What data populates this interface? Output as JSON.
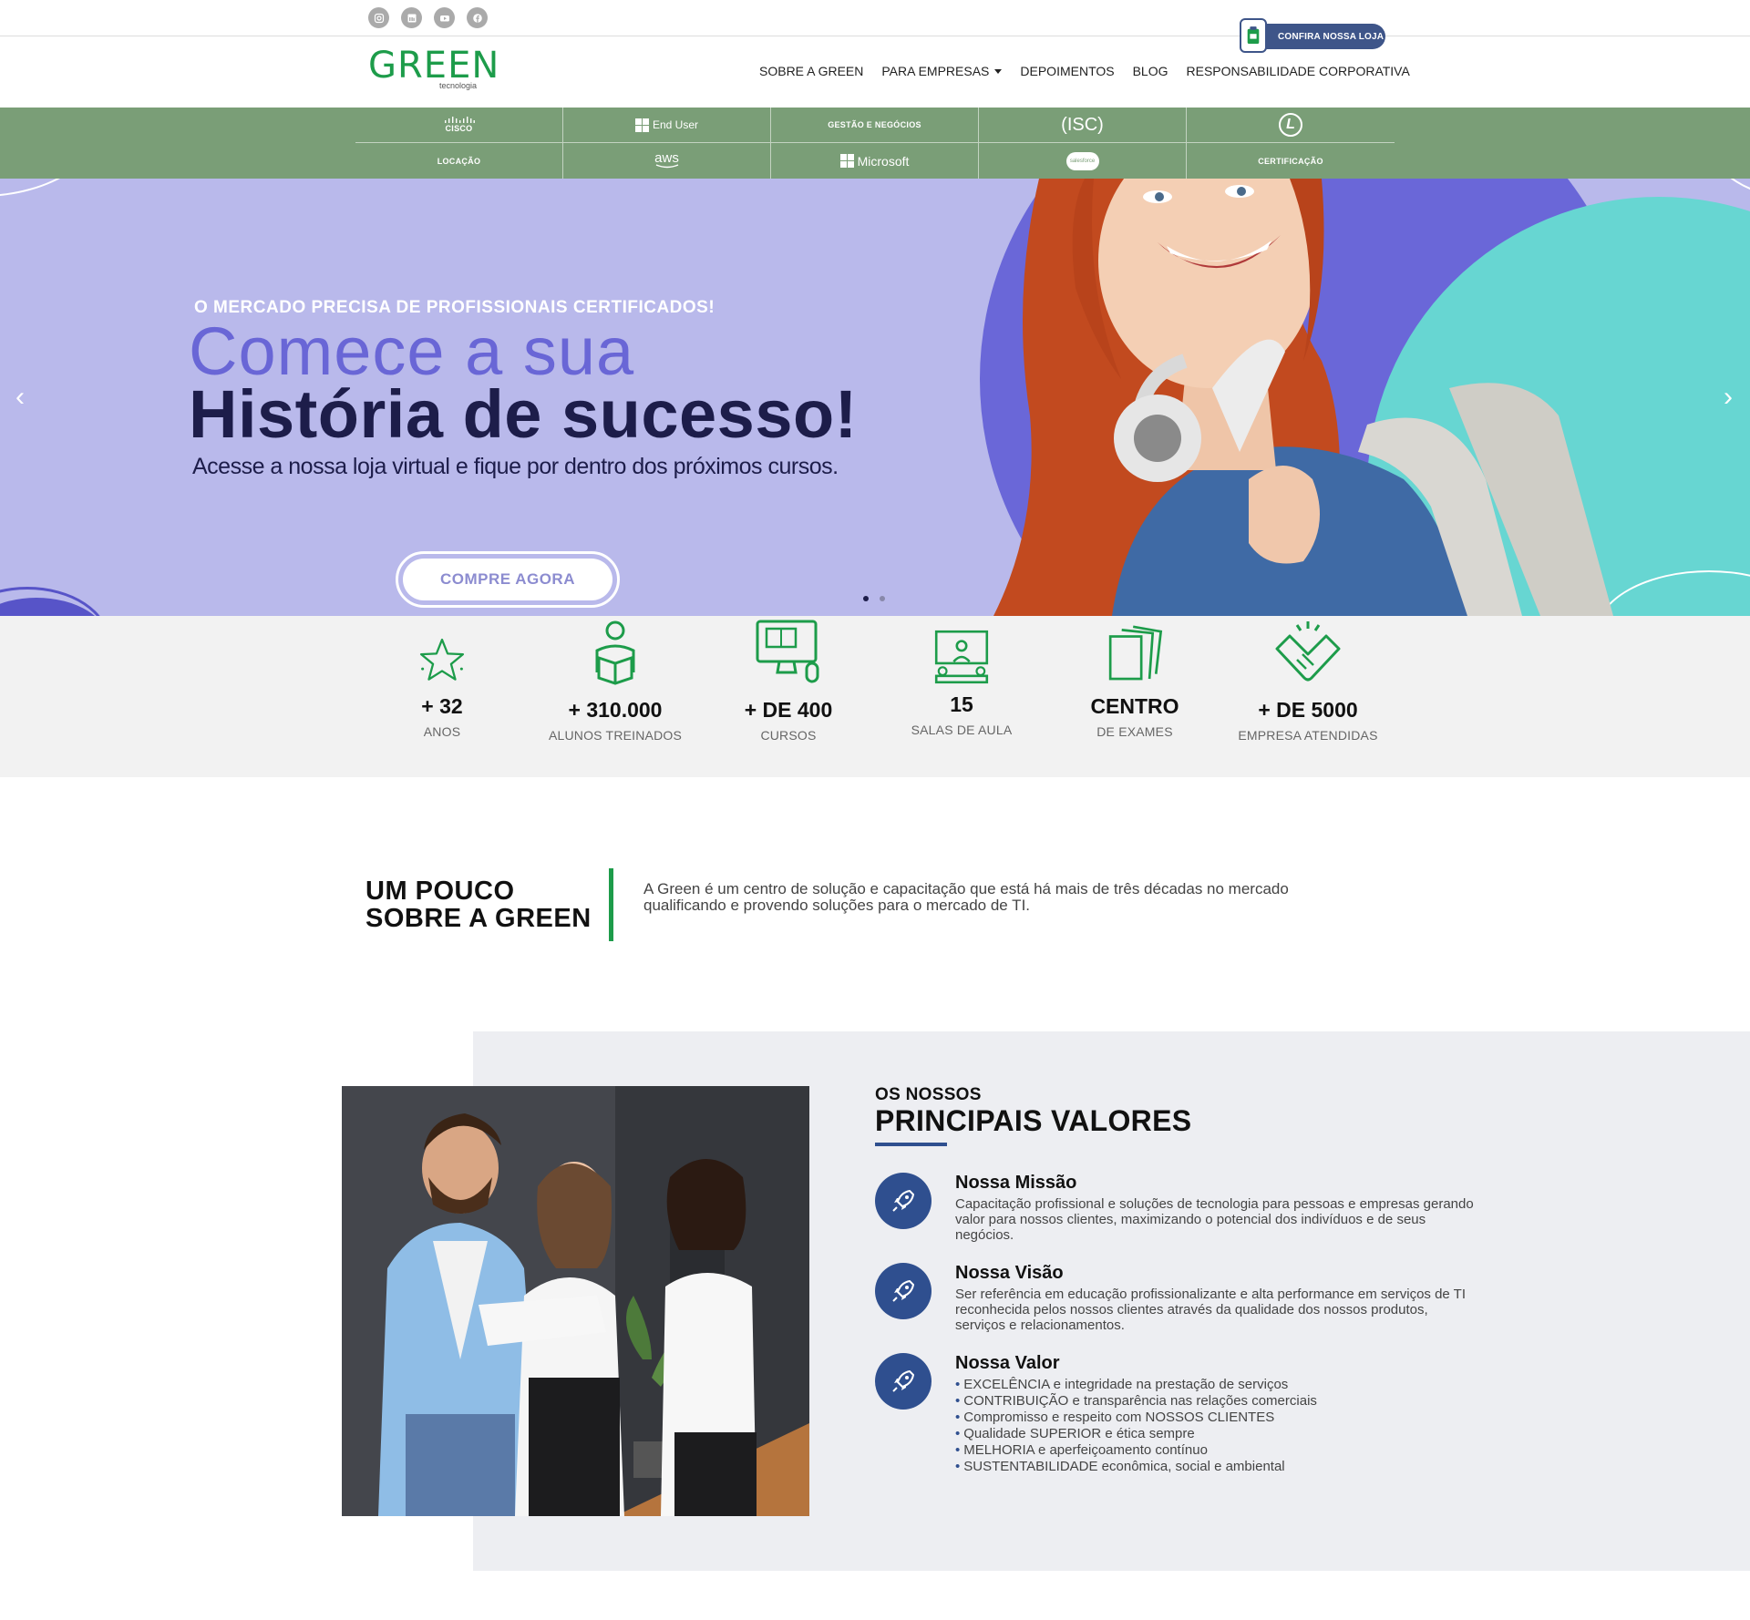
{
  "topbar": {
    "social": [
      "instagram-icon",
      "linkedin-icon",
      "youtube-icon",
      "facebook-icon"
    ],
    "store_label": "CONFIRA NOSSA LOJA"
  },
  "header": {
    "logo": "GREEN",
    "logo_sub": "tecnologia",
    "nav": [
      "SOBRE A GREEN",
      "PARA EMPRESAS",
      "DEPOIMENTOS",
      "BLOG",
      "RESPONSABILIDADE CORPORATIVA"
    ]
  },
  "partners": {
    "row1": [
      "CISCO",
      "End User",
      "GESTÃO E NEGÓCIOS",
      "(ISC)",
      "L"
    ],
    "row2": [
      "LOCAÇÃO",
      "aws",
      "Microsoft",
      "salesforce",
      "CERTIFICAÇÃO"
    ]
  },
  "hero": {
    "kicker": "O MERCADO PRECISA DE PROFISSIONAIS CERTIFICADOS!",
    "headline_light": "Comece a sua",
    "headline_bold": "História de sucesso!",
    "subtitle": "Acesse a nossa loja virtual e fique por dentro dos próximos cursos.",
    "cta": "COMPRE AGORA",
    "prev": "‹",
    "next": "›"
  },
  "stats": [
    {
      "icon": "star-icon",
      "value": "+ 32",
      "label": "ANOS"
    },
    {
      "icon": "student-reading-icon",
      "value": "+ 310.000",
      "label": "ALUNOS TREINADOS"
    },
    {
      "icon": "computer-course-icon",
      "value": "+ DE 400",
      "label": "CURSOS"
    },
    {
      "icon": "classroom-icon",
      "value": "15",
      "label": "SALAS DE AULA"
    },
    {
      "icon": "documents-icon",
      "value": "CENTRO",
      "label": "DE EXAMES"
    },
    {
      "icon": "handshake-icon",
      "value": "+ DE 5000",
      "label": "EMPRESA ATENDIDAS"
    }
  ],
  "about": {
    "title_1": "UM POUCO",
    "title_2": "SOBRE A GREEN",
    "text": "A Green é um centro de solução e capacitação que está há mais de três décadas no mercado qualificando e provendo soluções para o mercado de TI."
  },
  "values": {
    "kicker": "OS NOSSOS",
    "title": "PRINCIPAIS VALORES",
    "mission": {
      "title": "Nossa Missão",
      "text": "Capacitação profissional e soluções de tecnologia para pessoas e empresas gerando valor para nossos clientes, maximizando o potencial dos indivíduos e de seus negócios."
    },
    "vision": {
      "title": "Nossa Visão",
      "text": "Ser referência em educação profissionalizante e alta performance em serviços de TI reconhecida pelos nossos clientes através da qualidade dos nossos produtos, serviços e relacionamentos."
    },
    "value": {
      "title": "Nossa Valor",
      "items": [
        "EXCELÊNCIA e integridade na prestação de serviços",
        "CONTRIBUIÇÃO e transparência nas relações comerciais",
        "Compromisso e respeito com NOSSOS CLIENTES",
        "Qualidade SUPERIOR e ética sempre",
        "MELHORIA e aperfeiçoamento contínuo",
        "SUSTENTABILIDADE econômica, social e ambiental"
      ]
    }
  },
  "colors": {
    "brand_green": "#1d9c4a",
    "band_green": "#7a9e77",
    "hero_lilac": "#b9b9eb",
    "hero_purple": "#6a67d8",
    "hero_teal": "#67d6d2",
    "navy": "#2f4f8f"
  }
}
